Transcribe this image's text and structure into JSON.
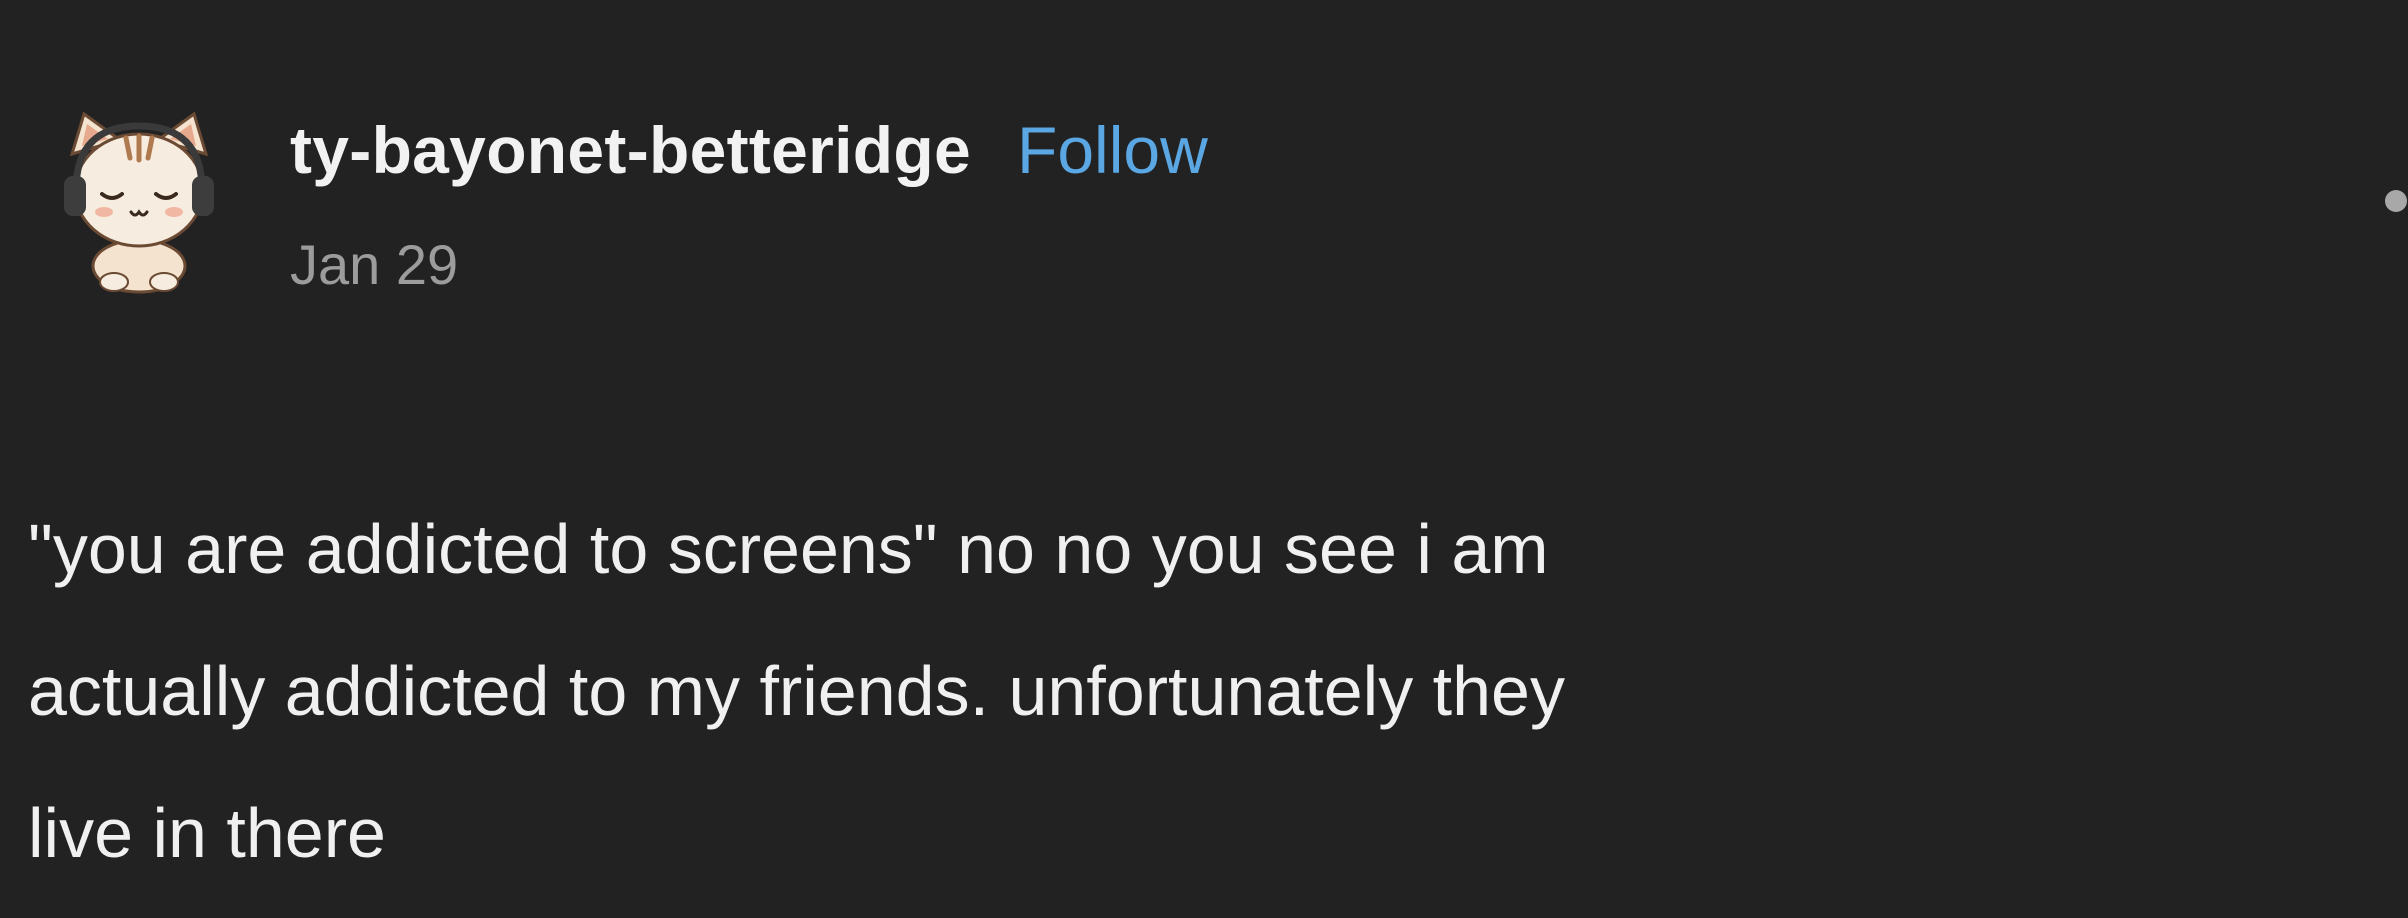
{
  "post": {
    "username": "ty-bayonet-betteridge",
    "follow_label": "Follow",
    "date": "Jan 29",
    "avatar_icon": "cat-with-headphones-avatar-icon",
    "more_icon": "more-options-icon",
    "body_lines": [
      "\"you are addicted to screens\" no no you see i am",
      "actually addicted to my friends. unfortunately they",
      "live in there"
    ]
  },
  "colors": {
    "background": "#222223",
    "username": "#f2f2f2",
    "follow": "#5aa7e3",
    "date": "#9c9c9c",
    "body": "#f0f0f0"
  }
}
